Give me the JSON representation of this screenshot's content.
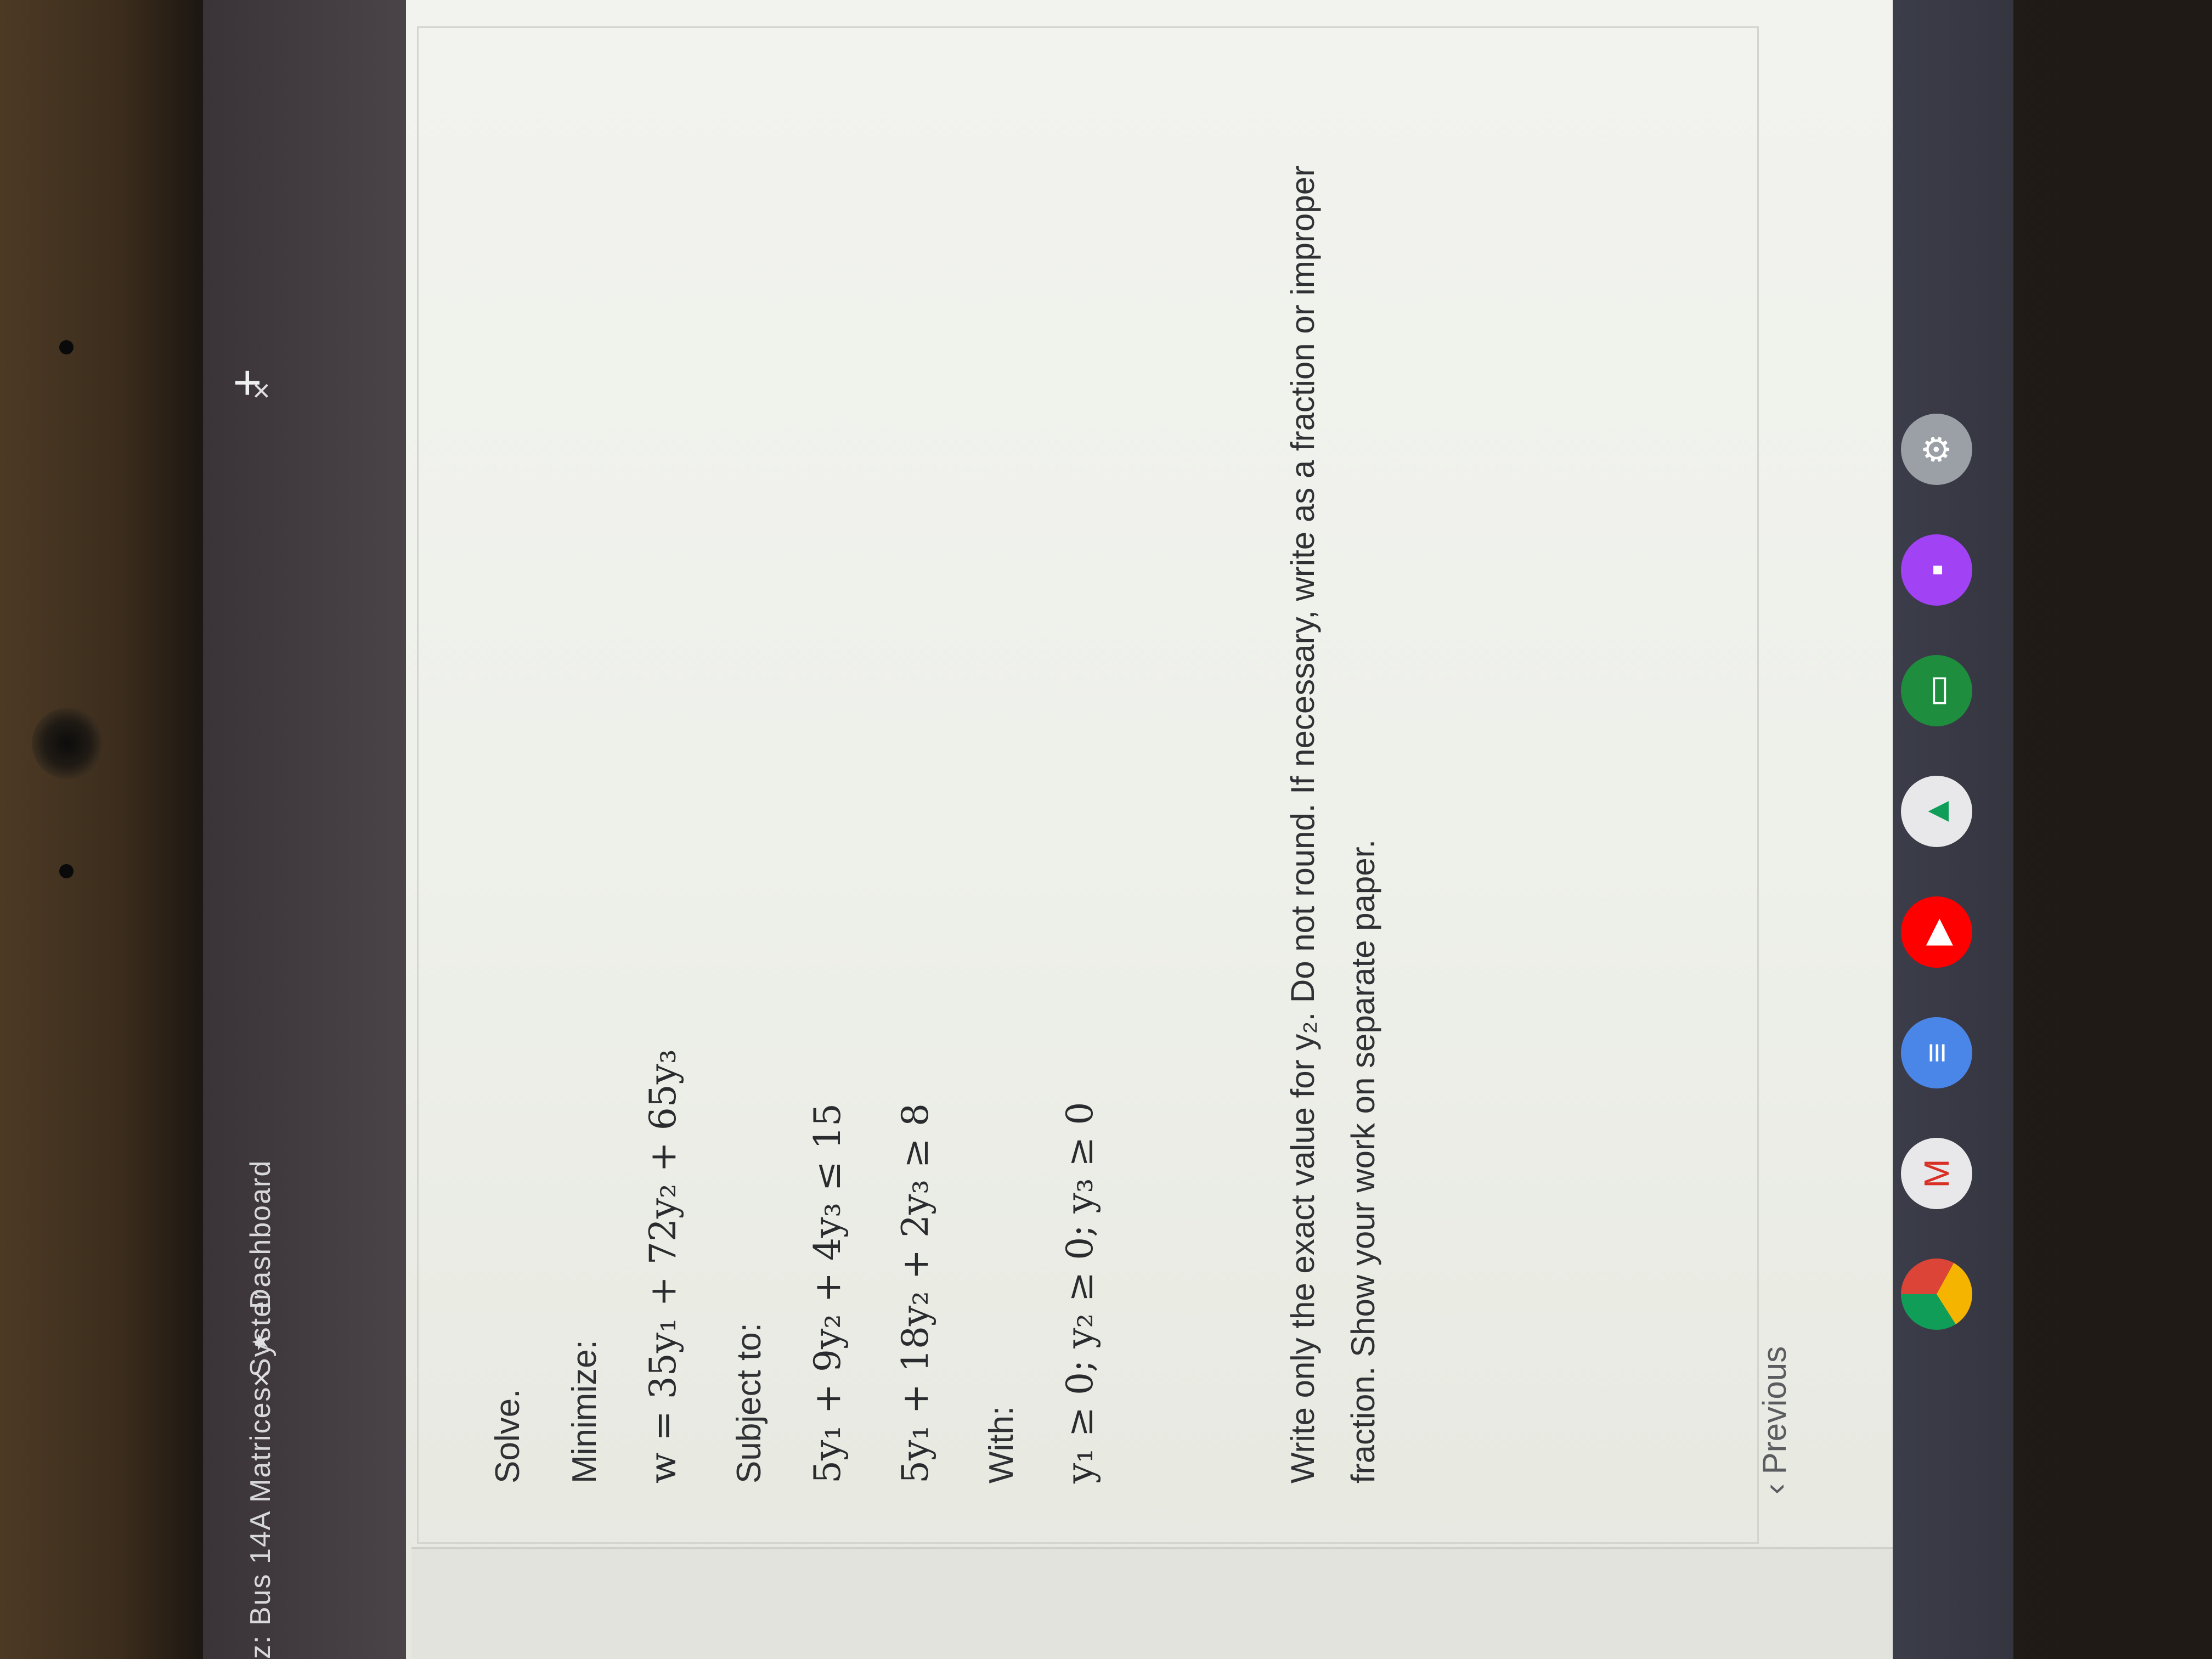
{
  "browser": {
    "tabs": [
      {
        "label": "z: Bus 14A Matrices Syster",
        "close": "×"
      },
      {
        "label": "Dashboard",
        "close": "×"
      }
    ],
    "new_tab": "+"
  },
  "question": {
    "intro": "Solve.",
    "minimize_label": "Minimize:",
    "objective": "w = 35y₁ + 72y₂ + 65y₃",
    "subject_to_label": "Subject to:",
    "constraints": [
      "5y₁ + 9y₂ + 4y₃ ≤ 15",
      "5y₁ + 18y₂ + 2y₃ ≥ 8"
    ],
    "with_label": "With:",
    "nonnegativity": "y₁ ≥ 0; y₂ ≥ 0; y₃ ≥ 0",
    "instructions": "Write only the exact value for y₂. Do not round. If necessary, write as a fraction or improper fraction. Show your work on separate paper."
  },
  "navigation": {
    "previous_label": "Previous"
  },
  "shelf": {
    "icons": [
      "chrome-icon",
      "gmail-icon",
      "docs-icon",
      "youtube-icon",
      "drive-icon",
      "classroom-icon",
      "photos-icon",
      "settings-icon"
    ]
  }
}
